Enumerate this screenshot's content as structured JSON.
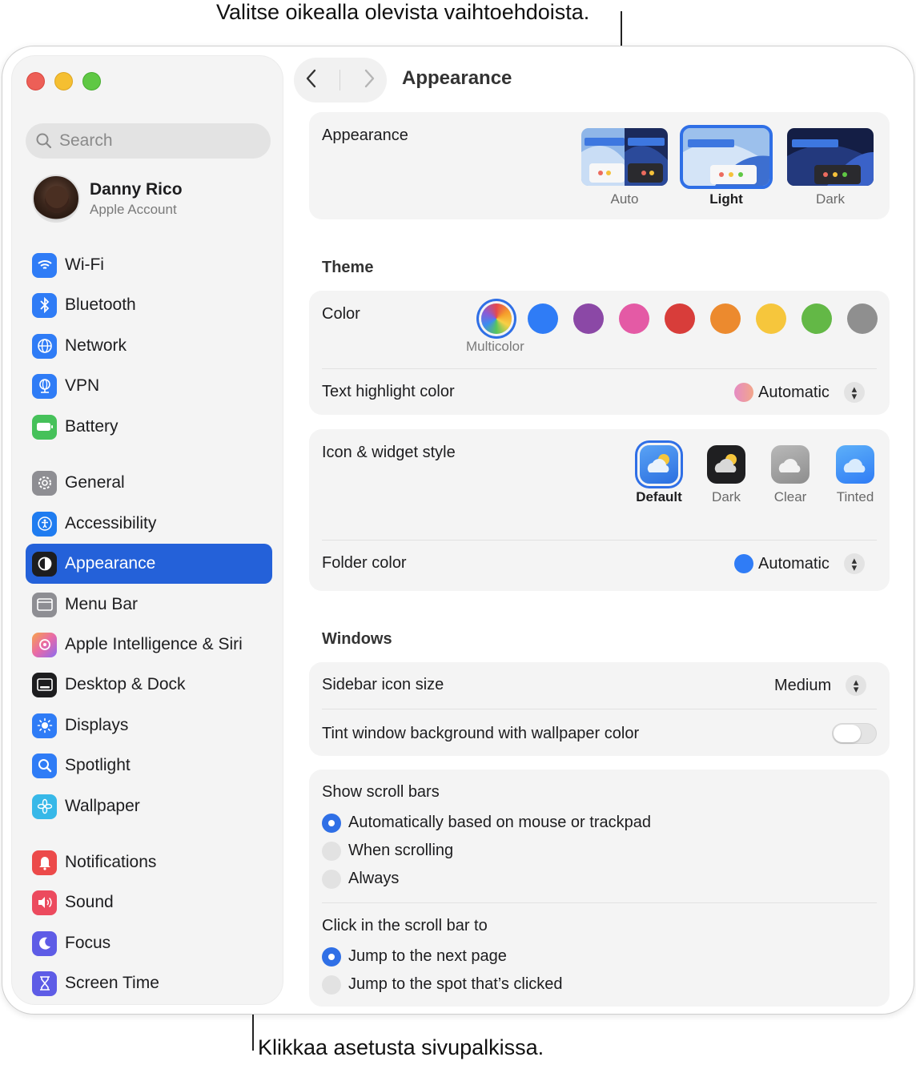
{
  "callouts": {
    "top": "Valitse oikealla olevista vaihtoehdoista.",
    "bottom": "Klikkaa asetusta sivupalkissa."
  },
  "sidebar": {
    "search_placeholder": "Search",
    "account": {
      "name": "Danny Rico",
      "subtitle": "Apple Account"
    },
    "items": [
      {
        "label": "Wi-Fi",
        "icon": "wifi-icon",
        "color": "#2f7cf6"
      },
      {
        "label": "Bluetooth",
        "icon": "bluetooth-icon",
        "color": "#2f7cf6"
      },
      {
        "label": "Network",
        "icon": "globe-icon",
        "color": "#2f7cf6"
      },
      {
        "label": "VPN",
        "icon": "vpn-globe-icon",
        "color": "#2f7cf6"
      },
      {
        "label": "Battery",
        "icon": "battery-icon",
        "color": "#46c15a"
      },
      {
        "label": "General",
        "icon": "gear-icon",
        "color": "#8e8e93"
      },
      {
        "label": "Accessibility",
        "icon": "accessibility-icon",
        "color": "#1f7cf0"
      },
      {
        "label": "Appearance",
        "icon": "appearance-icon",
        "color": "#1d1d1f",
        "active": true
      },
      {
        "label": "Menu Bar",
        "icon": "menu-bar-icon",
        "color": "#8e8e93"
      },
      {
        "label": "Apple Intelligence & Siri",
        "icon": "siri-icon",
        "color": "#e86aa8"
      },
      {
        "label": "Desktop & Dock",
        "icon": "dock-icon",
        "color": "#1d1d1f"
      },
      {
        "label": "Displays",
        "icon": "sun-icon",
        "color": "#2f7cf6"
      },
      {
        "label": "Spotlight",
        "icon": "magnifier-icon",
        "color": "#2f7cf6"
      },
      {
        "label": "Wallpaper",
        "icon": "flower-icon",
        "color": "#37b8e8"
      },
      {
        "label": "Notifications",
        "icon": "bell-icon",
        "color": "#ec4a4a"
      },
      {
        "label": "Sound",
        "icon": "speaker-icon",
        "color": "#ec4a5e"
      },
      {
        "label": "Focus",
        "icon": "moon-icon",
        "color": "#5e5ce6"
      },
      {
        "label": "Screen Time",
        "icon": "hourglass-icon",
        "color": "#5e5ce6"
      }
    ]
  },
  "toolbar": {
    "title": "Appearance"
  },
  "appearance": {
    "label": "Appearance",
    "options": [
      {
        "label": "Auto",
        "selected": false
      },
      {
        "label": "Light",
        "selected": true
      },
      {
        "label": "Dark",
        "selected": false
      }
    ]
  },
  "theme": {
    "section_title": "Theme",
    "color_label": "Color",
    "selected_color_name": "Multicolor",
    "colors": [
      "multicolor",
      "#2f7cf6",
      "#8b48a6",
      "#e45aa5",
      "#d83d3a",
      "#ec8a2e",
      "#f6c63c",
      "#63b846",
      "#8f8f8f"
    ],
    "highlight_label": "Text highlight color",
    "highlight_value": "Automatic",
    "icon_style_label": "Icon & widget style",
    "icon_styles": [
      {
        "label": "Default",
        "selected": true
      },
      {
        "label": "Dark",
        "selected": false
      },
      {
        "label": "Clear",
        "selected": false
      },
      {
        "label": "Tinted",
        "selected": false
      }
    ],
    "folder_label": "Folder color",
    "folder_value": "Automatic",
    "folder_color": "#2f7cf6"
  },
  "windows": {
    "section_title": "Windows",
    "sidebar_icon_label": "Sidebar icon size",
    "sidebar_icon_value": "Medium",
    "tint_label": "Tint window background with wallpaper color",
    "tint_on": false
  },
  "scroll": {
    "show_label": "Show scroll bars",
    "show_options": [
      {
        "label": "Automatically based on mouse or trackpad",
        "selected": true
      },
      {
        "label": "When scrolling",
        "selected": false
      },
      {
        "label": "Always",
        "selected": false
      }
    ],
    "click_label": "Click in the scroll bar to",
    "click_options": [
      {
        "label": "Jump to the next page",
        "selected": true
      },
      {
        "label": "Jump to the spot that’s clicked",
        "selected": false
      }
    ]
  }
}
